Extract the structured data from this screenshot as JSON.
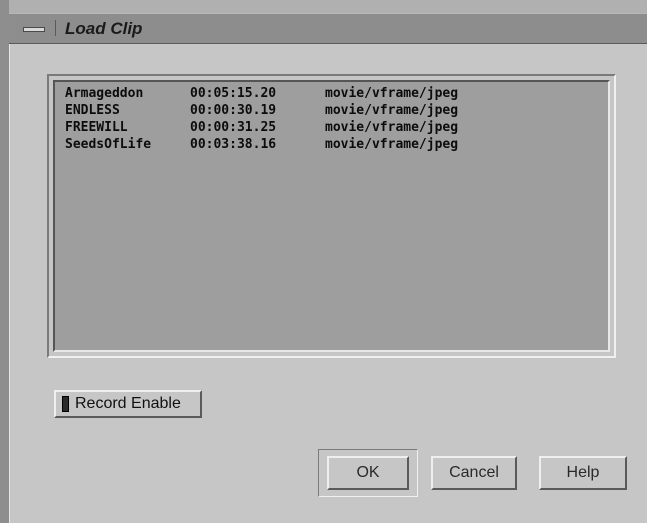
{
  "window": {
    "title": "Load Clip"
  },
  "clips": [
    {
      "name": "Armageddon",
      "duration": "00:05:15.20",
      "format": "movie/vframe/jpeg"
    },
    {
      "name": "ENDLESS",
      "duration": "00:00:30.19",
      "format": "movie/vframe/jpeg"
    },
    {
      "name": "FREEWILL",
      "duration": "00:00:31.25",
      "format": "movie/vframe/jpeg"
    },
    {
      "name": "SeedsOfLife",
      "duration": "00:03:38.16",
      "format": "movie/vframe/jpeg"
    }
  ],
  "record_enable": {
    "label": "Record Enable",
    "checked": false
  },
  "buttons": {
    "ok": "OK",
    "cancel": "Cancel",
    "help": "Help"
  }
}
